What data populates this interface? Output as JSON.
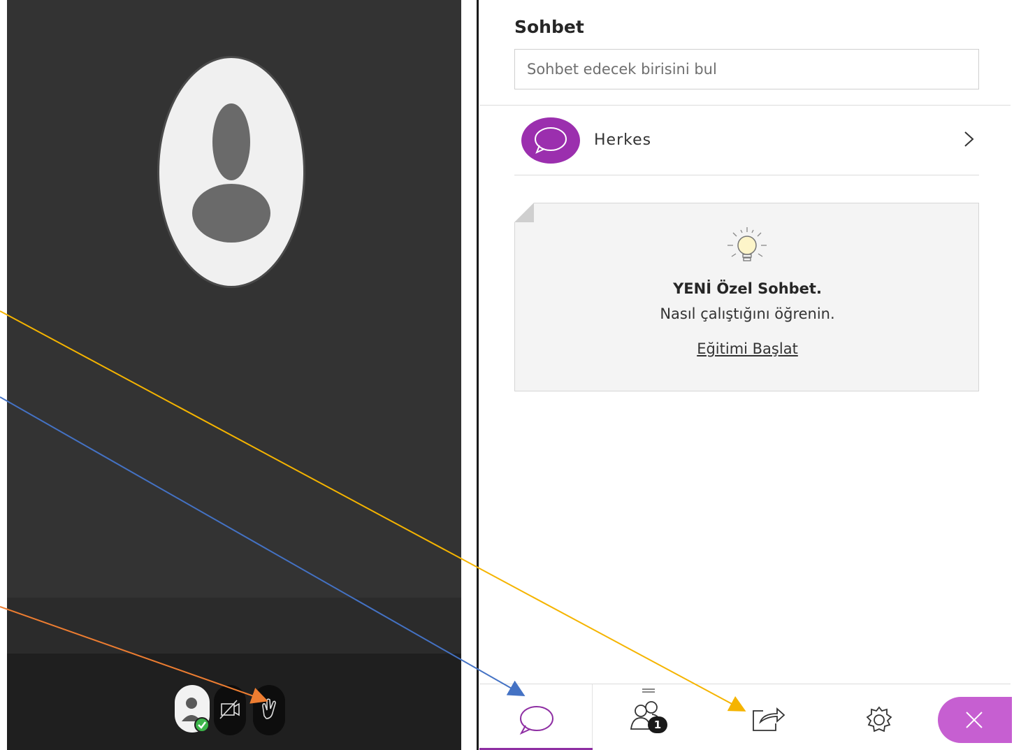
{
  "panel": {
    "title": "Sohbet",
    "search_placeholder": "Sohbet edecek birisini bul"
  },
  "conversations": [
    {
      "label": "Herkes"
    }
  ],
  "tip": {
    "title": "YENİ Özel Sohbet.",
    "subtitle": "Nasıl çalıştığını öğrenin.",
    "link": "Eğitimi Başlat"
  },
  "tabs": {
    "participants_count": "1",
    "active": "chat"
  },
  "video_controls": {
    "icons": [
      "avatar-status",
      "camera-off-icon",
      "raise-hand-icon"
    ]
  },
  "colors": {
    "accent_purple": "#9b2fae",
    "close_pink": "#c65fd1",
    "status_green": "#3cb54a",
    "arrow_yellow": "#f5b400",
    "arrow_blue": "#4472c4",
    "arrow_orange": "#ed7d31"
  }
}
